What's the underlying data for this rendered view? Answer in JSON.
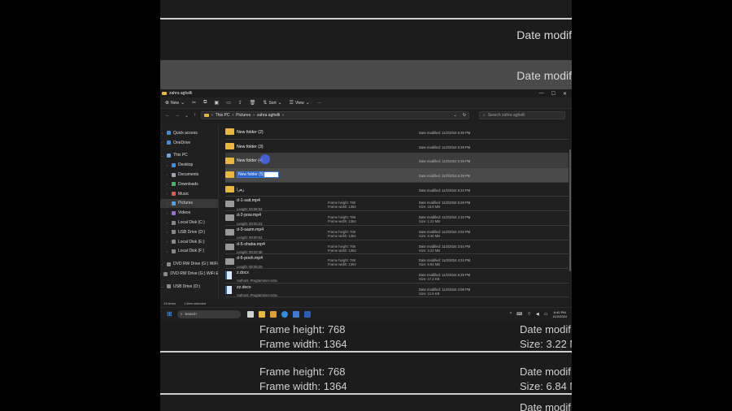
{
  "zoom_top": {
    "date_text_1": "Date modif",
    "date_text_2": "Date modif"
  },
  "window": {
    "title": "zahra aghelli",
    "controls": {
      "minimize": "—",
      "maximize": "☐",
      "close": "✕"
    }
  },
  "toolbar": {
    "new_label": "New",
    "sort_label": "Sort",
    "view_label": "View",
    "more_label": "···"
  },
  "address": {
    "back": "←",
    "forward": "→",
    "down": "⌄",
    "up": "↑",
    "crumbs": [
      "This PC",
      "Pictures",
      "zahra aghelli"
    ],
    "refresh": "↻",
    "search_placeholder": "Search zahra aghelli"
  },
  "sidebar": {
    "items": [
      {
        "label": "Quick access",
        "color": "#3a8ee6"
      },
      {
        "label": "OneDrive",
        "color": "#3a8ee6"
      },
      {
        "label": "This PC",
        "color": "#5fa8e8"
      },
      {
        "label": "Desktop",
        "color": "#3a8ee6"
      },
      {
        "label": "Documents",
        "color": "#9aa6b8"
      },
      {
        "label": "Downloads",
        "color": "#3fb86b"
      },
      {
        "label": "Music",
        "color": "#e05a4f"
      },
      {
        "label": "Pictures",
        "color": "#4fa3e0"
      },
      {
        "label": "Videos",
        "color": "#9b6ae0"
      },
      {
        "label": "Local Disk (C:)",
        "color": "#8a8a8a"
      },
      {
        "label": "USB Drive (D:)",
        "color": "#8a8a8a"
      },
      {
        "label": "Local Disk (E:)",
        "color": "#8a8a8a"
      },
      {
        "label": "Local Disk (F:)",
        "color": "#8a8a8a"
      },
      {
        "label": "DVD RW Drive (G:) WiFi",
        "color": "#8a8a8a"
      },
      {
        "label": "DVD RW Drive (G:) WiFi E",
        "color": "#8a8a8a"
      },
      {
        "label": "USB Drive (D:)",
        "color": "#8a8a8a"
      }
    ]
  },
  "files": [
    {
      "name": "New folder (2)",
      "date": "Date modified: 11/2/2024 6:35 PM"
    },
    {
      "name": "New folder (3)",
      "date": "Date modified: 11/2/2024 6:39 PM"
    },
    {
      "name": "New folder (4)",
      "date": "Date modified: 11/2/2024 6:39 PM"
    },
    {
      "name": "New folder (5)",
      "date": "Date modified: 11/2/2024 6:39 PM"
    },
    {
      "name": "زهرا",
      "date": "Date modified: 11/2/2024 6:34 PM"
    },
    {
      "name": "d-1-sait.mp4",
      "length": "Length: 00:08:02",
      "fh": "Frame height: 768",
      "fw": "Frame width: 1364",
      "date": "Date modified: 11/2/2024 6:28 PM",
      "size": "Size: 18.8 MB"
    },
    {
      "name": "d-2-pow.mp4",
      "length": "Length: 00:00:23",
      "fh": "Frame height: 768",
      "fw": "Frame width: 1364",
      "date": "Date modified: 11/2/2024 4:10 PM",
      "size": "Size: 1.21 MB"
    },
    {
      "name": "d-3-sazm.mp4",
      "length": "Length: 00:00:02",
      "fh": "Frame height: 768",
      "fw": "Frame width: 1364",
      "date": "Date modified: 11/2/2024 4:02 PM",
      "size": "Size: 8.46 MB"
    },
    {
      "name": "d-5-shaba.mp4",
      "length": "Length: 00:03:38",
      "fh": "Frame height: 768",
      "fw": "Frame width: 1364",
      "date": "Date modified: 11/2/2024 3:54 PM",
      "size": "Size: 3.22 MB"
    },
    {
      "name": "d-6-posh.mp4",
      "length": "Length: 00:06:29",
      "fh": "Frame height: 768",
      "fw": "Frame width: 1364",
      "date": "Date modified: 11/2/2024 4:34 PM",
      "size": "Size: 6.84 MB"
    },
    {
      "name": "z.docx",
      "authors": "Authors: Programmer-ezra",
      "date": "Date modified: 11/2/2024 6:29 PM",
      "size": "Size: 17.2 KB"
    },
    {
      "name": "zz.docx",
      "authors": "Authors: Programmer-ezra",
      "date": "Date modified: 11/2/2024 4:08 PM",
      "size": "Size: 12.5 KB"
    }
  ],
  "rename_value": "New folder (5)",
  "status": {
    "count": "13 items",
    "selected": "1 item selected"
  },
  "taskbar": {
    "search_label": "Search",
    "time": "6:40 PM",
    "date": "11/2/2024",
    "tray_caret": "^"
  },
  "zoom_bot": {
    "fh1": "Frame height:  768",
    "fw1": "Frame width:  1364",
    "dm1": "Date modif",
    "size1": "Size: 3.22 M",
    "fh2": "Frame height:  768",
    "fw2": "Frame width:  1364",
    "dm2": "Date modif",
    "size2": "Size: 6.84 M",
    "dm3": "Date modif"
  }
}
